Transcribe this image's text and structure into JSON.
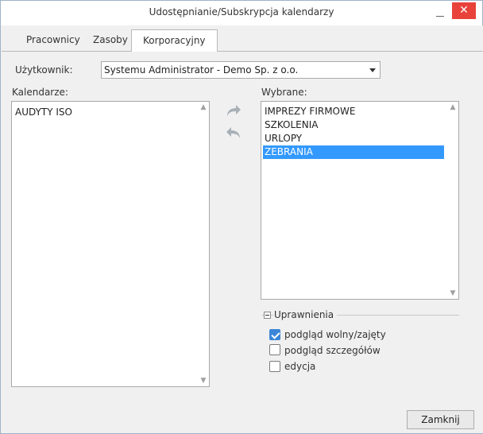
{
  "window": {
    "title": "Udostępnianie/Subskrypcja kalendarzy",
    "minimize_icon": "minimize-icon",
    "close_icon": "close-icon",
    "close_glyph": "✕"
  },
  "tabs": [
    {
      "label": "Pracownicy",
      "active": false
    },
    {
      "label": "Zasoby",
      "active": false
    },
    {
      "label": "Korporacyjny",
      "active": true
    }
  ],
  "user_field": {
    "label": "Użytkownik:",
    "value": "Systemu Administrator - Demo Sp. z o.o."
  },
  "calendars": {
    "label": "Kalendarze:",
    "items": [
      "AUDYTY ISO"
    ]
  },
  "selected": {
    "label": "Wybrane:",
    "items": [
      "IMPREZY FIRMOWE",
      "SZKOLENIA",
      "URLOPY",
      "ZEBRANIA"
    ],
    "selected_index": 3
  },
  "permissions": {
    "legend": "Uprawnienia",
    "options": [
      {
        "label": "podgląd wolny/zajęty",
        "checked": true
      },
      {
        "label": "podgląd szczegółów",
        "checked": false
      },
      {
        "label": "edycja",
        "checked": false
      }
    ]
  },
  "buttons": {
    "close_label": "Zamknij"
  },
  "colors": {
    "selection": "#3399ff",
    "close_button": "#e8423a",
    "checkbox_checked": "#3b86d8"
  }
}
